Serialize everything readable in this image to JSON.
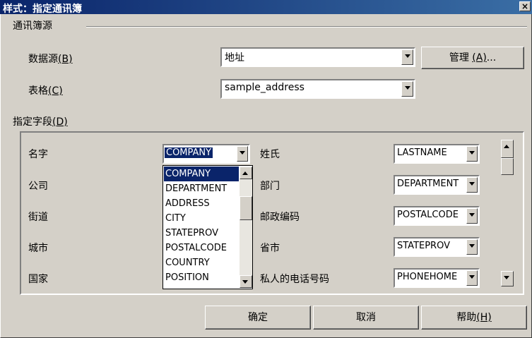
{
  "window": {
    "title": "样式：指定通讯簿",
    "close_glyph": "×"
  },
  "source_group": {
    "label": "通讯簿源"
  },
  "datasource": {
    "label": "数据源",
    "mnemonic": "(B)",
    "value": "地址"
  },
  "manage_button": {
    "label": "管理",
    "mnemonic": "(A)",
    "suffix": "..."
  },
  "table": {
    "label": "表格",
    "mnemonic": "(C)",
    "value": "sample_address"
  },
  "assign_fields": {
    "label": "指定字段",
    "mnemonic": "(D)"
  },
  "fields": {
    "left": [
      {
        "label": "名字",
        "value": "COMPANY"
      },
      {
        "label": "公司"
      },
      {
        "label": "街道"
      },
      {
        "label": "城市"
      },
      {
        "label": "国家"
      }
    ],
    "right": [
      {
        "label": "姓氏",
        "value": "LASTNAME"
      },
      {
        "label": "部门",
        "value": "DEPARTMENT"
      },
      {
        "label": "邮政编码",
        "value": "POSTALCODE"
      },
      {
        "label": "省市",
        "value": "STATEPROV"
      },
      {
        "label": "私人的电话号码",
        "value": "PHONEHOME"
      }
    ]
  },
  "dropdown_list": {
    "options": [
      "COMPANY",
      "DEPARTMENT",
      "ADDRESS",
      "CITY",
      "STATEPROV",
      "POSTALCODE",
      "COUNTRY",
      "POSITION"
    ],
    "selected": "COMPANY"
  },
  "buttons": {
    "ok": {
      "label": "确定"
    },
    "cancel": {
      "label": "取消"
    },
    "help": {
      "label": "帮助",
      "mnemonic": "(H)"
    }
  }
}
